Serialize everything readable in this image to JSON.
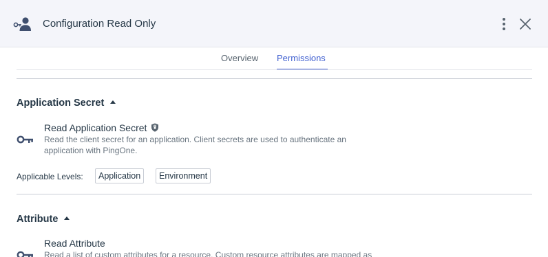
{
  "header": {
    "title": "Configuration Read Only",
    "role_icon": "user-key-icon",
    "menu_icon": "kebab-menu-icon",
    "close_icon": "close-icon"
  },
  "tabs": [
    {
      "label": "Overview",
      "active": false
    },
    {
      "label": "Permissions",
      "active": true
    }
  ],
  "colors": {
    "accent": "#3f5fd0",
    "text": "#253746",
    "muted": "#68747f",
    "header_bg": "#f4f5fa"
  },
  "sections": [
    {
      "title": "Application Secret",
      "expanded": true,
      "permissions": [
        {
          "name": "Read Application Secret",
          "icon": "key-icon",
          "badge_icon": "shield-icon",
          "description": "Read the client secret for an application. Client secrets are used to authenticate an application with PingOne.",
          "levels_label": "Applicable Levels:",
          "levels": [
            "Application",
            "Environment"
          ]
        }
      ]
    },
    {
      "title": "Attribute",
      "expanded": true,
      "permissions": [
        {
          "name": "Read Attribute",
          "icon": "key-icon",
          "description": "Read a list of custom attributes for a resource. Custom resource attributes are mapped as"
        }
      ]
    }
  ]
}
